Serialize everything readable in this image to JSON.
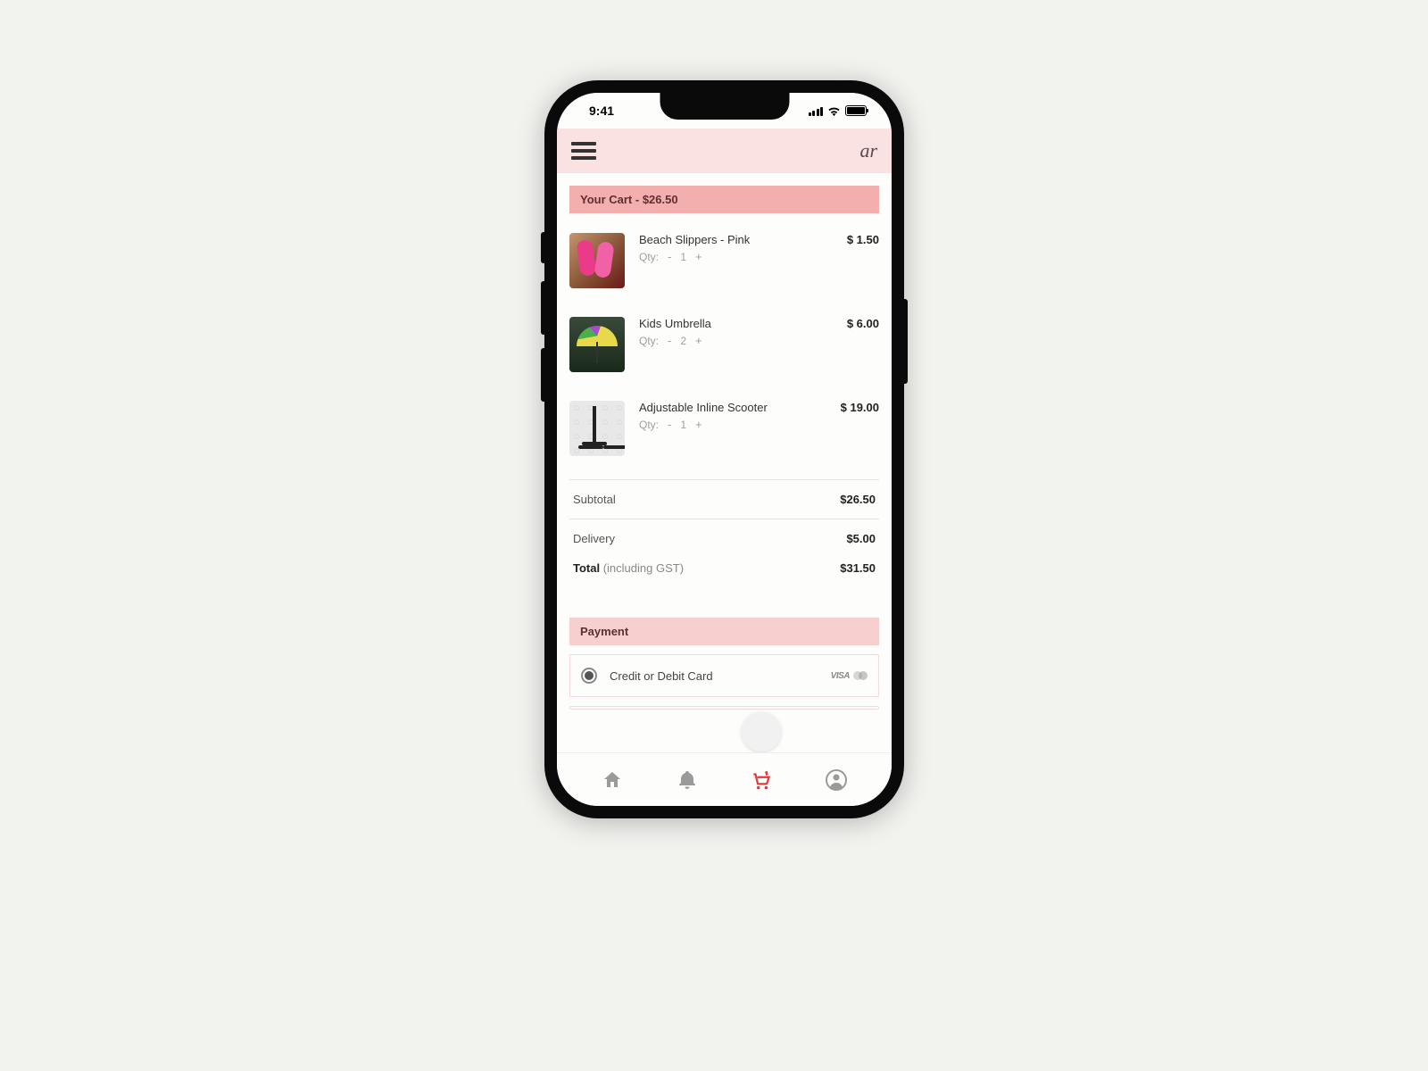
{
  "status": {
    "time": "9:41"
  },
  "header": {
    "logo_text": "ar"
  },
  "cart": {
    "banner": "Your Cart - $26.50",
    "qty_label": "Qty:",
    "items": [
      {
        "name": "Beach Slippers - Pink",
        "price": "$ 1.50",
        "qty": "1",
        "thumb": "slippers"
      },
      {
        "name": "Kids Umbrella",
        "price": "$ 6.00",
        "qty": "2",
        "thumb": "umbrella"
      },
      {
        "name": "Adjustable Inline Scooter",
        "price": "$ 19.00",
        "qty": "1",
        "thumb": "scooter"
      }
    ],
    "summary": {
      "subtotal_label": "Subtotal",
      "subtotal": "$26.50",
      "delivery_label": "Delivery",
      "delivery": "$5.00",
      "total_label": "Total",
      "total_note": "(including GST)",
      "total": "$31.50"
    }
  },
  "payment": {
    "banner": "Payment",
    "options": [
      {
        "label": "Credit or Debit Card",
        "selected": true,
        "logos": [
          "visa",
          "mastercard"
        ]
      }
    ]
  }
}
